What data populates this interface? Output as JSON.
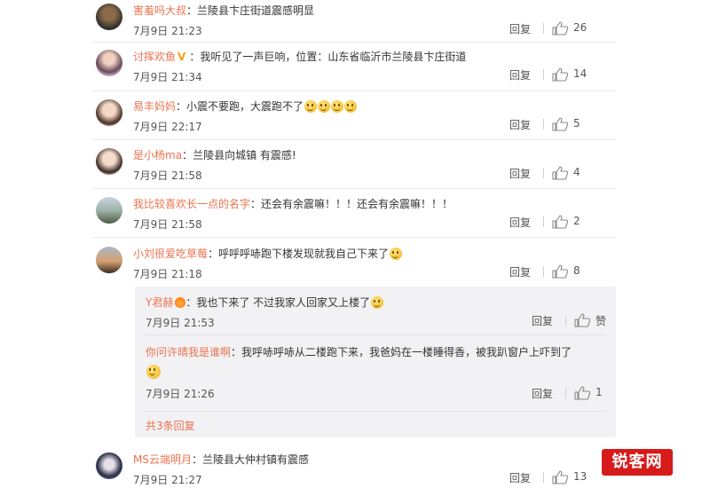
{
  "comments": [
    {
      "name": "害羞吗大叔",
      "badge": "",
      "text": "兰陵县卞庄街道震感明显",
      "emojis": 0,
      "time": "7月9日 21:23",
      "reply": "回复",
      "likes": "26"
    },
    {
      "name": "讨挥欢鱼",
      "badge": "V",
      "text": "我听见了一声巨响，位置：山东省临沂市兰陵县卞庄街道",
      "emojis": 0,
      "time": "7月9日 21:34",
      "reply": "回复",
      "likes": "14"
    },
    {
      "name": "易丰妈妈",
      "badge": "",
      "text": "小震不要跑，大震跑不了",
      "emojis": 4,
      "time": "7月9日 22:17",
      "reply": "回复",
      "likes": "5"
    },
    {
      "name": "是小杨ma",
      "badge": "",
      "text": "兰陵县向城镇 有震感!",
      "emojis": 0,
      "time": "7月9日 21:58",
      "reply": "回复",
      "likes": "4"
    },
    {
      "name": "我比较喜欢长一点的名字",
      "badge": "",
      "text": "还会有余震嘛！！！还会有余震嘛！！！",
      "emojis": 0,
      "time": "7月9日 21:58",
      "reply": "回复",
      "likes": "2"
    },
    {
      "name": "小刘很爱吃草莓",
      "badge": "",
      "text": "呼呼呼哧跑下楼发现就我自己下来了",
      "emojis": 1,
      "time": "7月9日 21:18",
      "reply": "回复",
      "likes": "8"
    }
  ],
  "replies": [
    {
      "name": "Y君赫",
      "text": "我也下来了  不过我家人回家又上楼了",
      "emojis": 1,
      "time": "7月9日 21:53",
      "reply": "回复",
      "likes": "赞"
    },
    {
      "name": "你问许晴我是谁啊",
      "text": "我呼哧呼哧从二楼跑下来，我爸妈在一楼睡得香，被我趴窗户上吓到了",
      "emojis": 1,
      "time": "7月9日 21:26",
      "reply": "回复",
      "likes": "1"
    }
  ],
  "more_replies": "共3条回复",
  "last_comment": {
    "name": "MS云端明月",
    "text": "兰陵县大仲村镇有震感",
    "time": "7月9日 21:27",
    "reply": "回复",
    "likes": "13"
  },
  "watermark": "锐客网",
  "icons": {
    "like": "thumbs-up-icon",
    "emoji": "smiley-emoji-icon"
  },
  "colors": {
    "username": "#eb7350",
    "reply_bg": "#f2f2f5",
    "watermark": "#d71a1a"
  }
}
